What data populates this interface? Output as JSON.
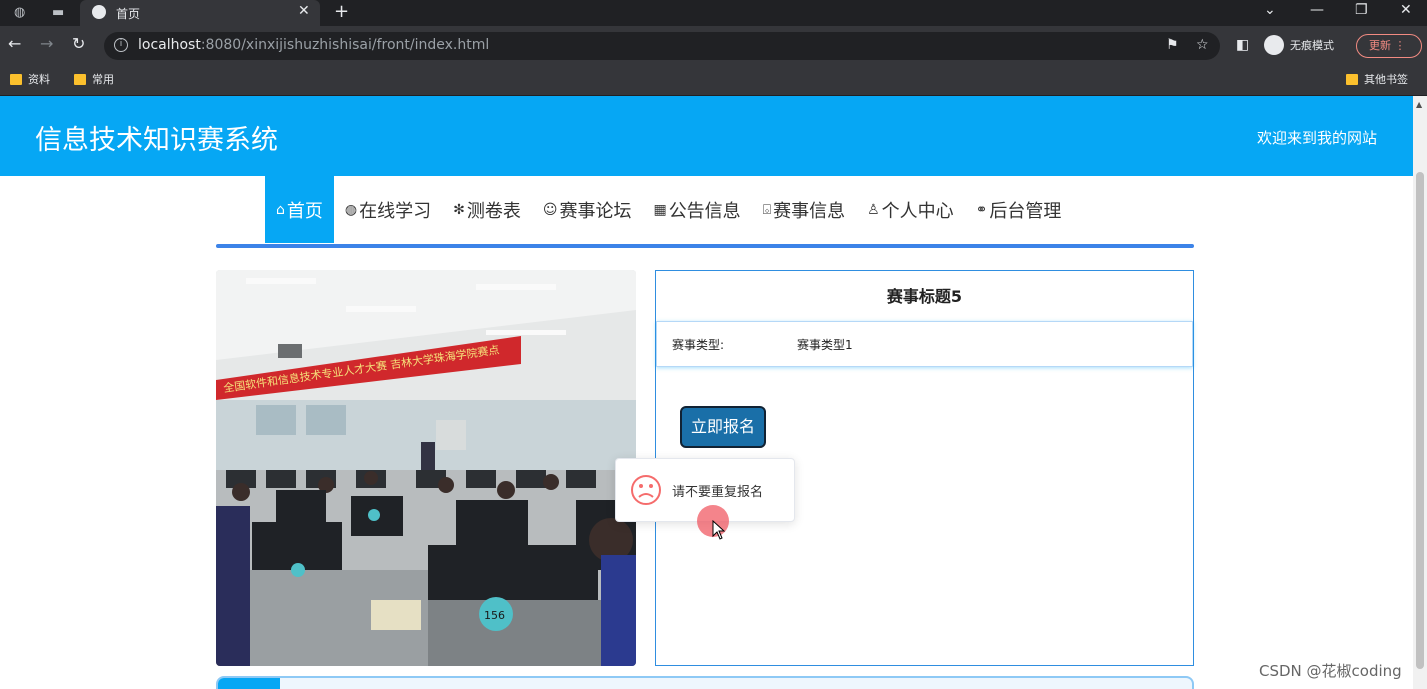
{
  "browser": {
    "tab_title": "首页",
    "url_host": "localhost",
    "url_rest": ":8080/xinxijishuzhishisai/front/index.html",
    "incognito_label": "无痕模式",
    "update_label": "更新",
    "bookmarks": [
      "资料",
      "常用"
    ],
    "other_bookmarks": "其他书签"
  },
  "site": {
    "title": "信息技术知识赛系统",
    "welcome": "欢迎来到我的网站"
  },
  "nav": [
    {
      "label": "首页",
      "icon": "home-icon",
      "glyph": "⌂"
    },
    {
      "label": "在线学习",
      "icon": "globe-icon",
      "glyph": "◍"
    },
    {
      "label": "测卷表",
      "icon": "asterisk-icon",
      "glyph": "✻"
    },
    {
      "label": "赛事论坛",
      "icon": "smile-icon",
      "glyph": "☺"
    },
    {
      "label": "公告信息",
      "icon": "grid-icon",
      "glyph": "▦"
    },
    {
      "label": "赛事信息",
      "icon": "book-icon",
      "glyph": "⌺"
    },
    {
      "label": "个人中心",
      "icon": "user-icon",
      "glyph": "♙"
    },
    {
      "label": "后台管理",
      "icon": "link-icon",
      "glyph": "⚭"
    }
  ],
  "detail": {
    "title": "赛事标题5",
    "type_label": "赛事类型:",
    "type_value": "赛事类型1",
    "signup_label": "立即报名"
  },
  "photo": {
    "banner_text": "全国软件和信息技术专业人才大赛 吉林大学珠海学院赛点"
  },
  "toast": {
    "message": "请不要重复报名",
    "icon": "sad-face-icon"
  },
  "watermark": "CSDN @花椒coding"
}
